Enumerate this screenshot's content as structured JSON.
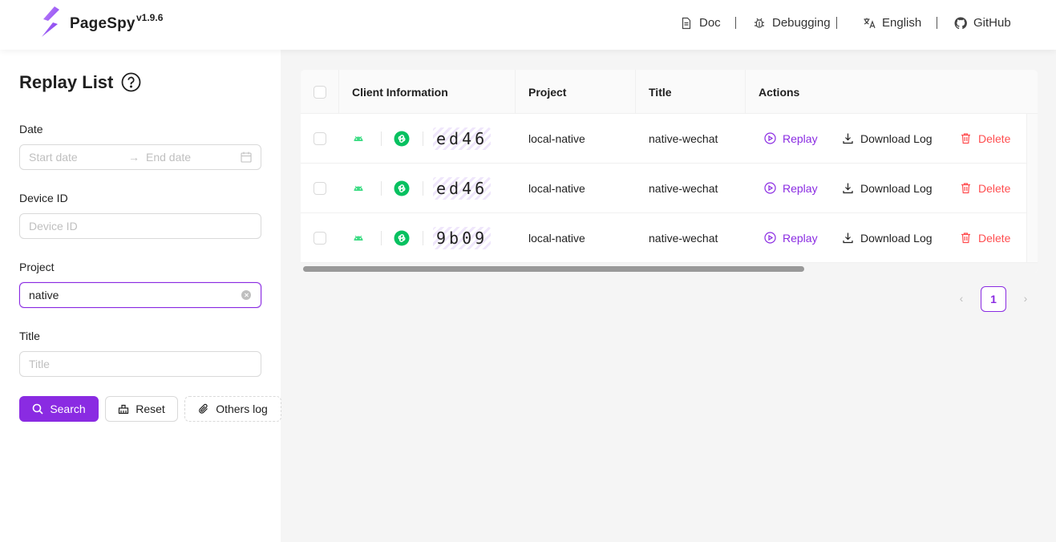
{
  "header": {
    "brand": "PageSpy",
    "version": "v1.9.6",
    "nav": {
      "doc": "Doc",
      "debugging": "Debugging",
      "language": "English",
      "github": "GitHub"
    }
  },
  "sidebar": {
    "title": "Replay List",
    "date": {
      "label": "Date",
      "start_placeholder": "Start date",
      "end_placeholder": "End date"
    },
    "device_id": {
      "label": "Device ID",
      "placeholder": "Device ID"
    },
    "project": {
      "label": "Project",
      "value": "native"
    },
    "title_field": {
      "label": "Title",
      "placeholder": "Title"
    },
    "buttons": {
      "search": "Search",
      "reset": "Reset",
      "others_log": "Others log"
    }
  },
  "table": {
    "columns": [
      "Client Information",
      "Project",
      "Title",
      "Actions"
    ],
    "rows": [
      {
        "device_id": "ed46",
        "project": "local-native",
        "title": "native-wechat",
        "os_icon": "android-icon",
        "platform_icon": "wechat-mini-program-icon"
      },
      {
        "device_id": "ed46",
        "project": "local-native",
        "title": "native-wechat",
        "os_icon": "android-icon",
        "platform_icon": "wechat-mini-program-icon"
      },
      {
        "device_id": "9b09",
        "project": "local-native",
        "title": "native-wechat",
        "os_icon": "android-icon",
        "platform_icon": "wechat-mini-program-icon"
      }
    ],
    "actions": {
      "replay": "Replay",
      "download": "Download Log",
      "delete": "Delete"
    }
  },
  "pagination": {
    "current": "1"
  },
  "colors": {
    "primary": "#8a2be2",
    "danger": "#ff4d4f",
    "android": "#3ddc84",
    "wechat": "#07c160"
  }
}
